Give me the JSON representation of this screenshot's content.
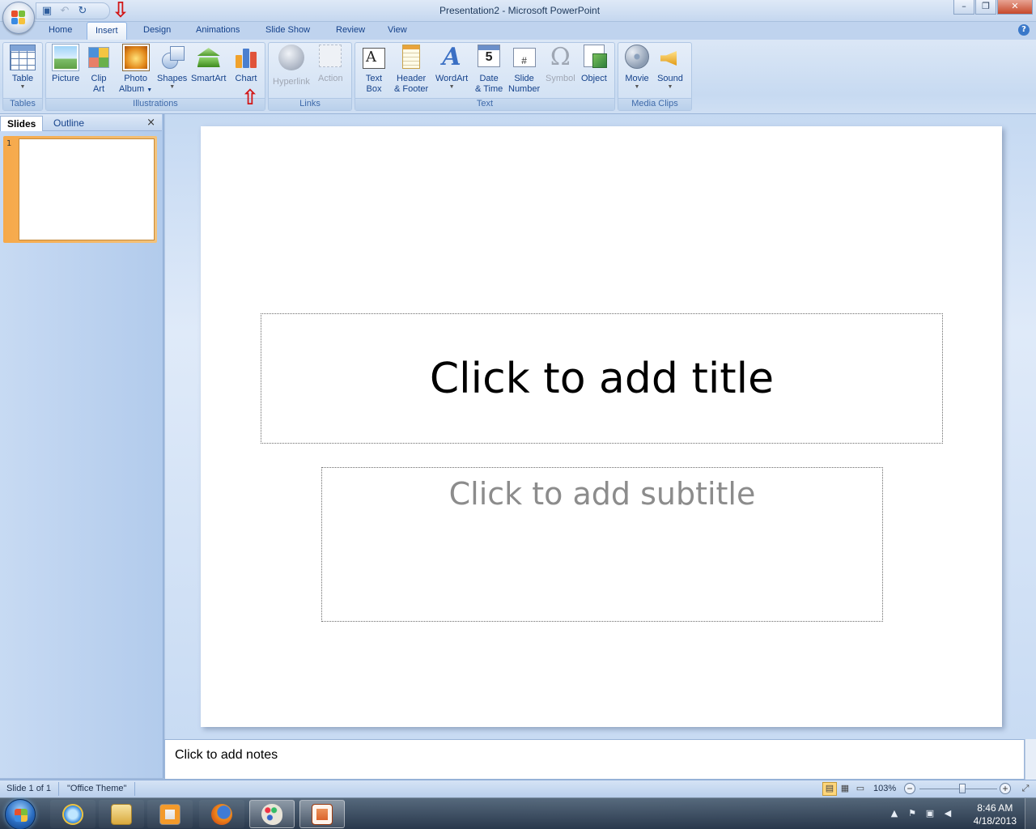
{
  "window": {
    "title": "Presentation2 - Microsoft PowerPoint",
    "controls": {
      "minimize": "–",
      "maximize": "❐",
      "close": "✕"
    }
  },
  "quick_access": {
    "save_icon": "save-icon",
    "undo_icon": "undo-icon",
    "redo_icon": "redo-icon"
  },
  "tabs": [
    {
      "label": "Home"
    },
    {
      "label": "Insert",
      "active": true
    },
    {
      "label": "Design"
    },
    {
      "label": "Animations"
    },
    {
      "label": "Slide Show"
    },
    {
      "label": "Review"
    },
    {
      "label": "View"
    }
  ],
  "ribbon": {
    "groups": {
      "tables": "Tables",
      "illustrations": "Illustrations",
      "links": "Links",
      "text": "Text",
      "media": "Media Clips"
    },
    "buttons": {
      "table": "Table",
      "picture": "Picture",
      "clip_art_1": "Clip",
      "clip_art_2": "Art",
      "photo_album_1": "Photo",
      "photo_album_2": "Album",
      "shapes": "Shapes",
      "smartart": "SmartArt",
      "chart": "Chart",
      "hyperlink": "Hyperlink",
      "action": "Action",
      "text_box_1": "Text",
      "text_box_2": "Box",
      "header_footer_1": "Header",
      "header_footer_2": "& Footer",
      "wordart": "WordArt",
      "date_time_1": "Date",
      "date_time_2": "& Time",
      "slide_number_1": "Slide",
      "slide_number_2": "Number",
      "symbol": "Symbol",
      "object": "Object",
      "movie": "Movie",
      "sound": "Sound"
    },
    "icon_text": {
      "textbox": "A",
      "date": "5",
      "slidenum": "#",
      "symbol": "Ω",
      "wordart": "A"
    }
  },
  "left_pane": {
    "tabs": [
      "Slides",
      "Outline"
    ],
    "close": "×",
    "slide_number": "1"
  },
  "slide": {
    "title_placeholder": "Click to add title",
    "subtitle_placeholder": "Click to add subtitle"
  },
  "notes": {
    "placeholder": "Click to add notes"
  },
  "status": {
    "slide_info": "Slide 1 of 1",
    "theme": "\"Office Theme\"",
    "zoom": "103%",
    "zoom_level": 0.55
  },
  "taskbar": {
    "clock_time": "8:46 AM",
    "clock_date": "4/18/2013"
  },
  "colors": {
    "accent_red": "#d21616",
    "chart_bar_1": "#f0a22c",
    "chart_bar_2": "#4b7fcf",
    "chart_bar_3": "#e0533a"
  }
}
